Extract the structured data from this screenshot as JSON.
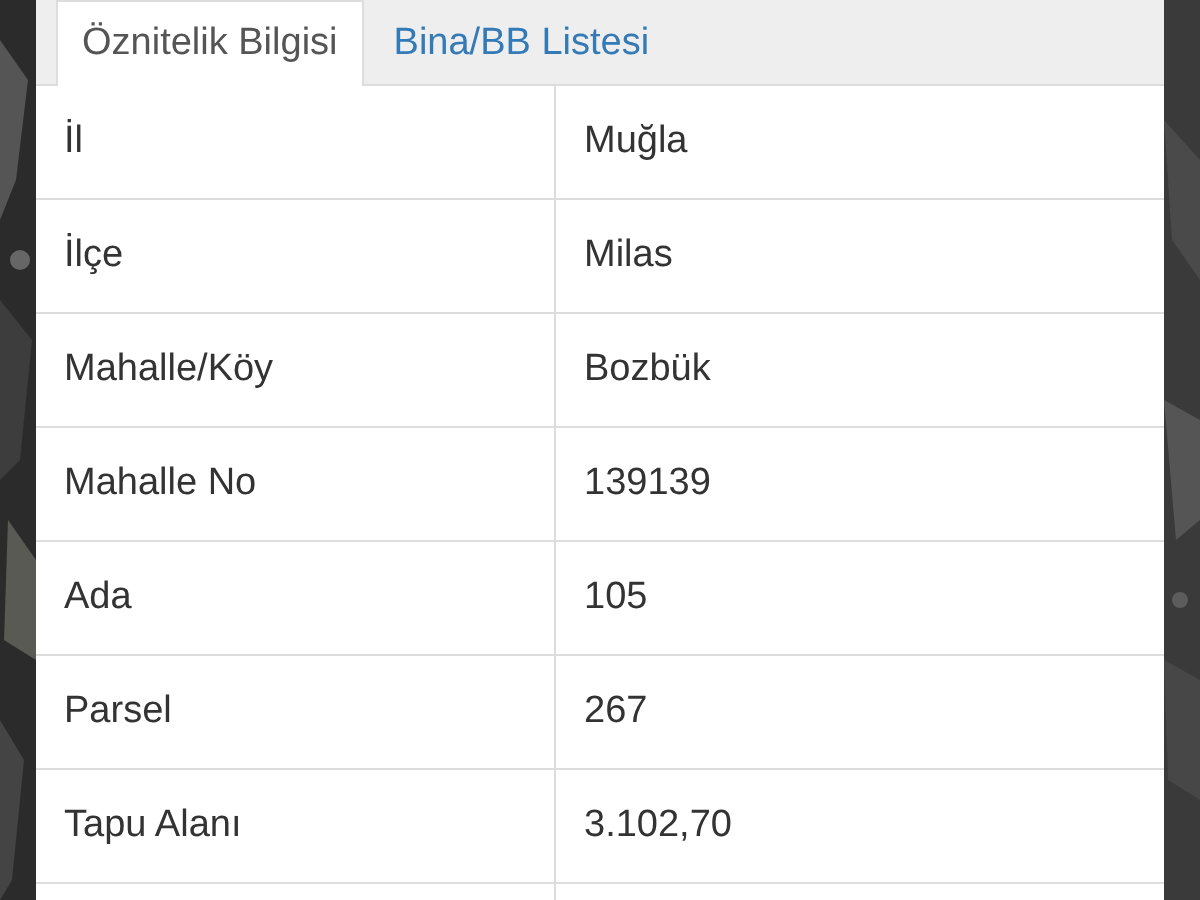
{
  "tabs": [
    {
      "label": "Öznitelik Bilgisi",
      "selected": true
    },
    {
      "label": "Bina/BB Listesi",
      "selected": false
    }
  ],
  "table": {
    "rows": [
      {
        "label": "İl",
        "value": "Muğla"
      },
      {
        "label": "İlçe",
        "value": "Milas"
      },
      {
        "label": "Mahalle/Köy",
        "value": "Bozbük"
      },
      {
        "label": "Mahalle No",
        "value": "139139"
      },
      {
        "label": "Ada",
        "value": "105"
      },
      {
        "label": "Parsel",
        "value": "267"
      },
      {
        "label": "Tapu Alanı",
        "value": "3.102,70"
      }
    ]
  }
}
